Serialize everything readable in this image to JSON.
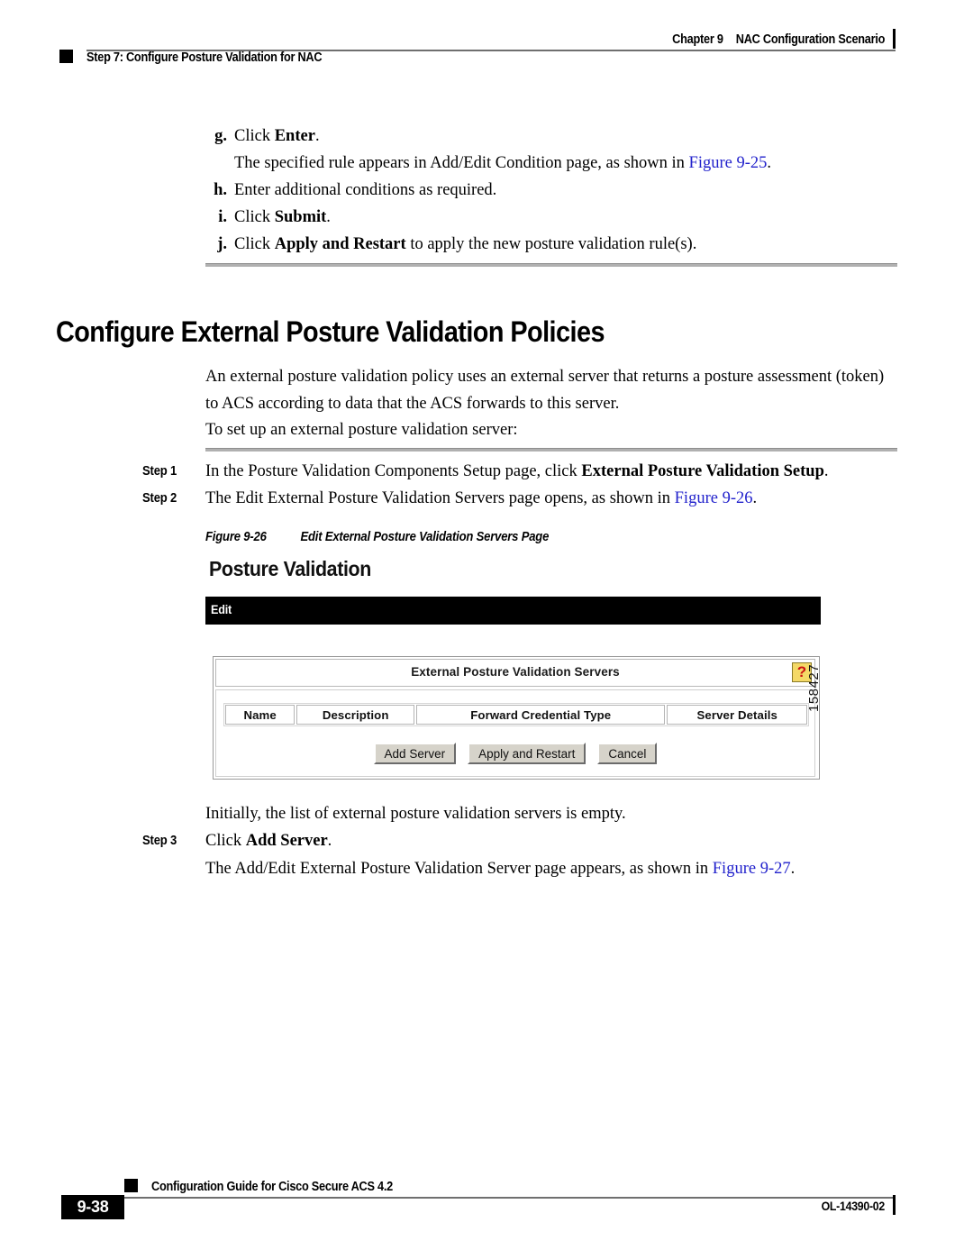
{
  "header": {
    "chapter": "Chapter 9",
    "chapter_title": "NAC Configuration Scenario",
    "running_title": "Step 7: Configure Posture Validation for NAC"
  },
  "lettered_steps": [
    {
      "marker": "g.",
      "text_before": "Click ",
      "bold": "Enter",
      "text_after": "."
    },
    {
      "marker": "h.",
      "text_before": "Enter additional conditions as required.",
      "bold": "",
      "text_after": ""
    },
    {
      "marker": "i.",
      "text_before": "Click ",
      "bold": "Submit",
      "text_after": "."
    },
    {
      "marker": "j.",
      "text_before": "Click ",
      "bold": "Apply and Restart",
      "text_after": " to apply the new posture validation rule(s)."
    }
  ],
  "lettered_sub_g": {
    "text_before": "The specified rule appears in Add/Edit Condition page, as shown in ",
    "link": "Figure 9-25",
    "text_after": "."
  },
  "section": {
    "heading": "Configure External Posture Validation Policies",
    "para1": "An external posture validation policy uses an external server that returns a posture assessment (token) to ACS according to data that the ACS forwards to this server.",
    "para2": "To set up an external posture validation server:"
  },
  "steps": [
    {
      "label": "Step 1",
      "text_before": "In the Posture Validation Components Setup page, click ",
      "bold": "External Posture Validation Setup",
      "text_after": ".",
      "link": "",
      "link_tail": ""
    },
    {
      "label": "Step 2",
      "text_before": "The Edit External Posture Validation Servers page opens, as shown in ",
      "bold": "",
      "text_after": "",
      "link": "Figure 9-26",
      "link_tail": "."
    }
  ],
  "figure": {
    "caption_number": "Figure 9-26",
    "caption_title": "Edit External Posture Validation Servers Page",
    "figure_id": "158427",
    "screenshot": {
      "title": "Posture Validation",
      "editbar_label": "Edit",
      "panel_title": "External Posture Validation Servers",
      "help_icon_glyph": "?",
      "columns": [
        "Name",
        "Description",
        "Forward Credential Type",
        "Server Details"
      ],
      "rows": [],
      "buttons": [
        "Add Server",
        "Apply and Restart",
        "Cancel"
      ]
    }
  },
  "after_figure": {
    "note": "Initially, the list of external posture validation servers is empty.",
    "step3": {
      "label": "Step 3",
      "text_before": "Click ",
      "bold": "Add Server",
      "text_after": "."
    },
    "step3_sub": {
      "text_before": "The Add/Edit External Posture Validation Server page appears, as shown in ",
      "link": "Figure 9-27",
      "text_after": "."
    }
  },
  "footer": {
    "page_number": "9-38",
    "guide_title": "Configuration Guide for Cisco Secure ACS 4.2",
    "doc_id": "OL-14390-02"
  },
  "colors": {
    "link": "#2222cc",
    "rule": "#b0b0b0",
    "editbar": "#000000",
    "help_icon_bg": "#f4d967",
    "help_icon_fg": "#cc1111",
    "button_face": "#d6d3ca"
  }
}
